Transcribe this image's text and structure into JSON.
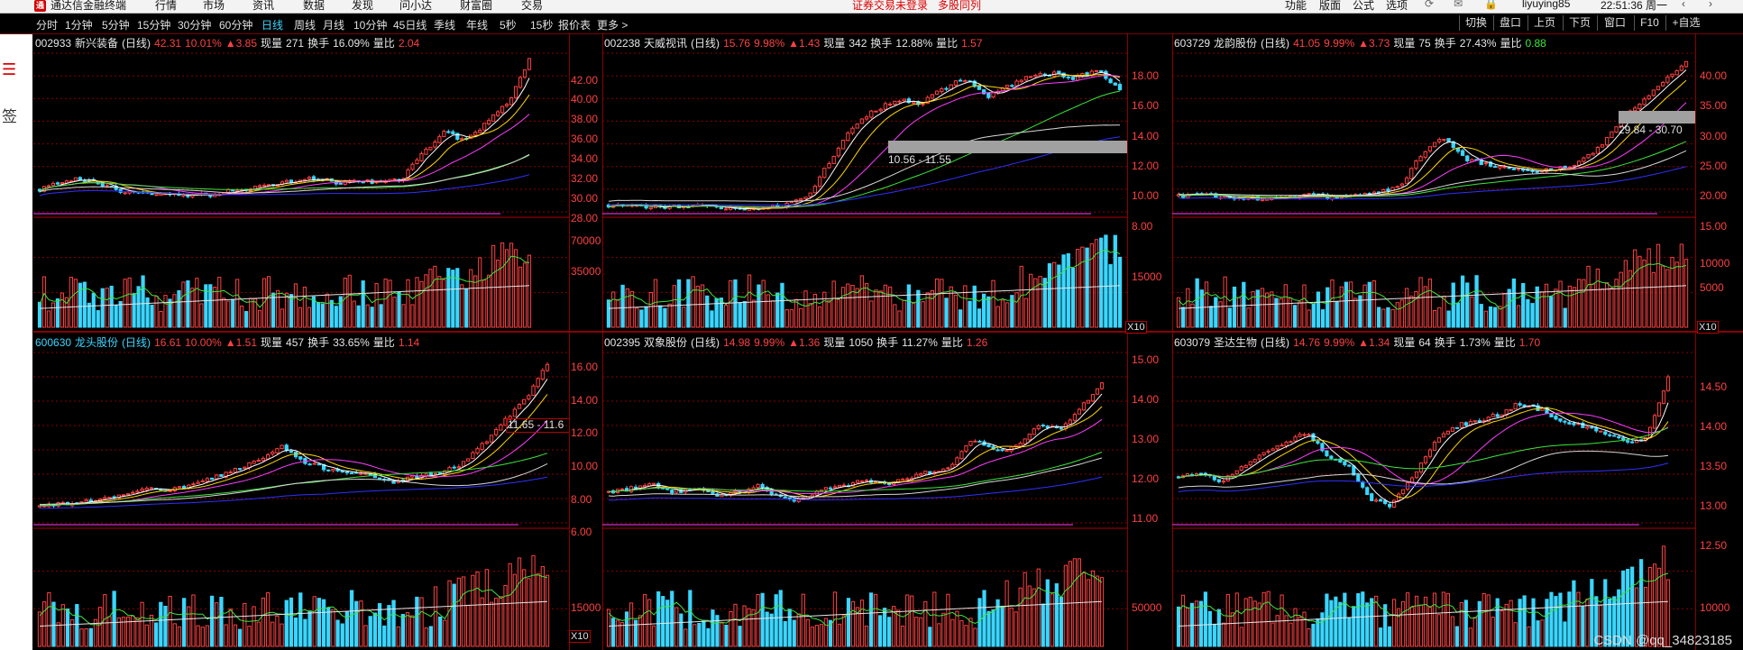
{
  "app": {
    "logo_text": "通",
    "title": "通达信金融终端",
    "menus": [
      "行情",
      "市场",
      "资讯",
      "数据",
      "发现",
      "问小达",
      "财富圈",
      "交易"
    ],
    "notice_1": "证券交易未登录",
    "notice_2": "多股同列",
    "right_menus": [
      "功能",
      "版面",
      "公式",
      "选项"
    ],
    "user": "liyuying85",
    "clock": "22:51:36 周一"
  },
  "periods": [
    "分时",
    "1分钟",
    "5分钟",
    "15分钟",
    "30分钟",
    "60分钟",
    "日线",
    "周线",
    "月线",
    "10分钟",
    "45日线",
    "季线",
    "年线",
    "5秒",
    "15秒",
    "报价表",
    "更多 >"
  ],
  "active_period": "日线",
  "right_buttons": [
    "切换",
    "盘口",
    "上页",
    "下页",
    "窗口",
    "F10",
    "+自选"
  ],
  "browser_strip": {
    "close_icon": "✕",
    "menu_icon": "☰",
    "label": "签"
  },
  "colors": {
    "up": "#ff4040",
    "down": "#3ad6ff",
    "ma5": "#ffffff",
    "ma10": "#ffd800",
    "ma20": "#ff3cff",
    "ma60": "#3ce63c",
    "ma120": "#d8d8d8",
    "ma250": "#3030ff",
    "grid": "#8a0000"
  },
  "charts": [
    {
      "code": "002933",
      "name": "新兴装备",
      "period": "(日线)",
      "price": "42.31",
      "pct": "10.01%",
      "chg": "▲3.85",
      "vol_label": "现量",
      "vol": "271",
      "turn_label": "换手",
      "turn": "16.09%",
      "ratio_label": "量比",
      "ratio": "2.04",
      "code_color": "white",
      "price_axis": "right",
      "price_ticks": [
        "42.00",
        "40.00",
        "38.00",
        "36.00",
        "34.00",
        "32.00",
        "30.00",
        "28.00"
      ],
      "vol_ticks": [
        "70000",
        "35000"
      ],
      "x10": "",
      "chart_data": {
        "type": "candlestick",
        "ylim": [
          27,
          43
        ],
        "trend": [
          29.2,
          30.0,
          30.4,
          29.6,
          29.0,
          28.8,
          29.0,
          28.6,
          28.7,
          29.2,
          29.4,
          29.8,
          30.2,
          30.4,
          29.9,
          30.1,
          30.0,
          30.3,
          33.0,
          35.0,
          34.2,
          36.0,
          38.0,
          42.31
        ]
      }
    },
    {
      "code": "002238",
      "name": "天威视讯",
      "period": "(日线)",
      "price": "15.76",
      "pct": "9.98%",
      "chg": "▲1.43",
      "vol_label": "现量",
      "vol": "342",
      "turn_label": "换手",
      "turn": "12.88%",
      "ratio_label": "量比",
      "ratio": "1.57",
      "code_color": "white",
      "price_axis": "right",
      "price_ticks": [
        "18.00",
        "16.00",
        "14.00",
        "12.00",
        "10.00",
        "8.00"
      ],
      "vol_ticks": [
        "15000"
      ],
      "x10": "X10",
      "annotation": "10.56 - 11.55",
      "chart_data": {
        "type": "candlestick",
        "ylim": [
          6.5,
          18.5
        ],
        "trend": [
          7.0,
          7.0,
          6.9,
          6.9,
          6.95,
          6.8,
          6.7,
          6.8,
          7.0,
          7.6,
          10.5,
          13.0,
          14.2,
          15.0,
          14.6,
          15.8,
          16.6,
          15.2,
          16.0,
          16.8,
          17.0,
          16.6,
          17.3,
          15.76
        ]
      }
    },
    {
      "code": "603729",
      "name": "龙韵股份",
      "period": "(日线)",
      "price": "41.05",
      "pct": "9.99%",
      "chg": "▲3.73",
      "vol_label": "现量",
      "vol": "75",
      "turn_label": "换手",
      "turn": "27.43%",
      "ratio_label": "量比",
      "ratio": "0.88",
      "code_color": "white",
      "price_axis": "right",
      "price_ticks": [
        "40.00",
        "35.00",
        "30.00",
        "25.00",
        "20.00",
        "15.00"
      ],
      "vol_ticks": [
        "10000",
        "5000"
      ],
      "x10": "X10",
      "annotation": "29.84 - 30.70",
      "chart_data": {
        "type": "candlestick",
        "ylim": [
          13,
          43
        ],
        "trend": [
          16.0,
          16.2,
          15.8,
          15.6,
          15.5,
          15.7,
          16.2,
          15.8,
          16.0,
          16.6,
          17.6,
          24.0,
          27.0,
          23.0,
          22.0,
          21.0,
          20.5,
          21.2,
          22.0,
          25.0,
          30.0,
          34.0,
          38.0,
          41.05
        ]
      }
    },
    {
      "code": "600630",
      "name": "龙头股份",
      "period": "(日线)",
      "price": "16.61",
      "pct": "10.00%",
      "chg": "▲1.51",
      "vol_label": "现量",
      "vol": "457",
      "turn_label": "换手",
      "turn": "33.65%",
      "ratio_label": "量比",
      "ratio": "1.14",
      "code_color": "cyan",
      "price_axis": "left",
      "price_ticks": [],
      "vol_ticks": [],
      "x10": "",
      "annotation": "11.65 - 11.6",
      "chart_data": {
        "type": "candlestick",
        "ylim": [
          5,
          17.5
        ],
        "trend": [
          6.2,
          6.4,
          6.6,
          6.8,
          7.0,
          7.6,
          7.4,
          7.8,
          8.4,
          9.0,
          9.6,
          10.6,
          9.4,
          9.0,
          8.8,
          8.4,
          8.0,
          8.4,
          8.6,
          9.2,
          10.6,
          12.4,
          14.0,
          16.61
        ]
      }
    },
    {
      "code": "002395",
      "name": "双象股份",
      "period": "(日线)",
      "price": "14.98",
      "pct": "9.99%",
      "chg": "▲1.36",
      "vol_label": "现量",
      "vol": "1050",
      "turn_label": "换手",
      "turn": "11.27%",
      "ratio_label": "量比",
      "ratio": "1.26",
      "code_color": "white",
      "price_axis": "left",
      "price_ticks": [
        "16.00",
        "14.00",
        "12.00",
        "10.00",
        "8.00",
        "6.00"
      ],
      "vol_ticks": [
        "15000"
      ],
      "x10": "X10",
      "chart_data": {
        "type": "candlestick",
        "ylim": [
          5,
          17
        ],
        "trend": [
          7.2,
          7.4,
          7.8,
          7.2,
          7.4,
          7.0,
          7.2,
          7.6,
          6.8,
          6.6,
          7.4,
          7.6,
          8.0,
          7.8,
          8.2,
          8.6,
          9.0,
          11.0,
          10.0,
          10.4,
          12.0,
          11.6,
          13.0,
          14.98
        ]
      }
    },
    {
      "code": "603079",
      "name": "圣达生物",
      "period": "(日线)",
      "price": "14.76",
      "pct": "9.99%",
      "chg": "▲1.34",
      "vol_label": "现量",
      "vol": "64",
      "turn_label": "换手",
      "turn": "1.73%",
      "ratio_label": "量比",
      "ratio": "1.70",
      "code_color": "white",
      "price_axis": "both",
      "price_ticks": [
        "15.00",
        "14.00",
        "13.00",
        "12.00",
        "11.00"
      ],
      "price_ticks_right": [
        "14.50",
        "14.00",
        "13.50",
        "13.00",
        "12.50"
      ],
      "vol_ticks": [
        "50000"
      ],
      "vol_ticks_right": [
        "10000"
      ],
      "x10": "",
      "chart_data": {
        "type": "candlestick",
        "ylim": [
          12.2,
          15.2
        ],
        "trend": [
          13.0,
          13.1,
          12.9,
          13.2,
          13.4,
          13.6,
          13.8,
          13.4,
          13.2,
          12.6,
          12.5,
          13.0,
          13.6,
          13.9,
          14.0,
          14.1,
          14.3,
          14.2,
          14.0,
          13.9,
          13.8,
          13.6,
          13.7,
          14.76
        ]
      }
    }
  ],
  "watermark": "CSDN @qq_34823185"
}
